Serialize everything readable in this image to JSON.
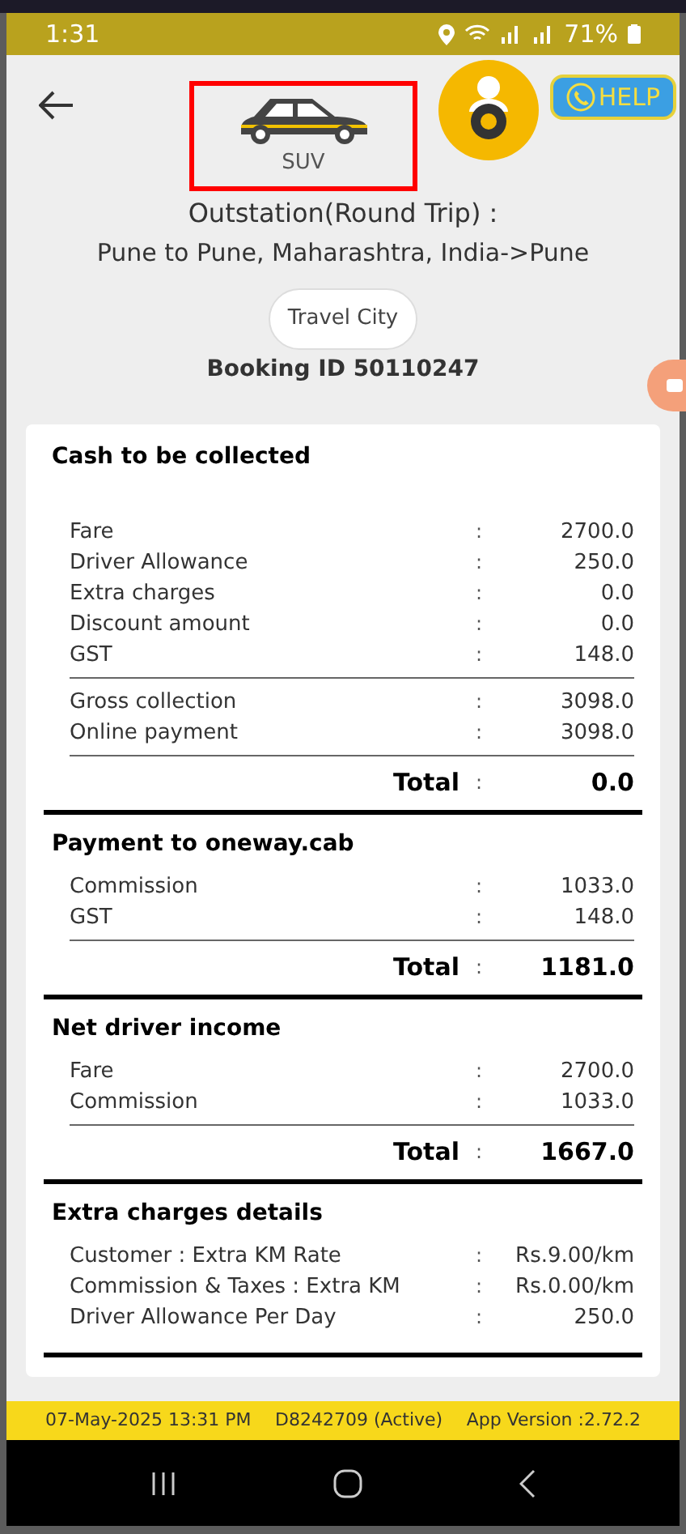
{
  "status_bar": {
    "time": "1:31",
    "battery": "71%"
  },
  "header": {
    "vehicle": "SUV",
    "help": "HELP",
    "trip_title": "Outstation(Round Trip) :",
    "route": "Pune to Pune, Maharashtra, India->Pune",
    "city_chip": "Travel City",
    "booking": "Booking ID 50110247"
  },
  "sections": [
    {
      "title": "Cash to be collected",
      "groups": [
        [
          {
            "label": "Fare",
            "sep": ":",
            "value": "2700.0"
          },
          {
            "label": "Driver Allowance",
            "sep": ":",
            "value": "250.0"
          },
          {
            "label": "Extra charges",
            "sep": ":",
            "value": "0.0"
          },
          {
            "label": "Discount amount",
            "sep": ":",
            "value": "0.0"
          },
          {
            "label": "GST",
            "sep": ":",
            "value": "148.0"
          }
        ],
        [
          {
            "label": "Gross collection",
            "sep": ":",
            "value": "3098.0"
          },
          {
            "label": "Online payment",
            "sep": ":",
            "value": "3098.0"
          }
        ]
      ],
      "total": {
        "label": "Total",
        "sep": ":",
        "value": "0.0"
      }
    },
    {
      "title": "Payment to oneway.cab",
      "groups": [
        [
          {
            "label": "Commission",
            "sep": ":",
            "value": "1033.0"
          },
          {
            "label": "GST",
            "sep": ":",
            "value": "148.0"
          }
        ]
      ],
      "total": {
        "label": "Total",
        "sep": ":",
        "value": "1181.0"
      }
    },
    {
      "title": "Net driver income",
      "groups": [
        [
          {
            "label": "Fare",
            "sep": ":",
            "value": "2700.0"
          },
          {
            "label": "Commission",
            "sep": ":",
            "value": "1033.0"
          }
        ]
      ],
      "total": {
        "label": "Total",
        "sep": ":",
        "value": "1667.0"
      }
    },
    {
      "title": "Extra charges details",
      "groups": [
        [
          {
            "label": "Customer : Extra KM Rate",
            "sep": ":",
            "value": "Rs.9.00/km"
          },
          {
            "label": "Commission & Taxes : Extra KM",
            "sep": ":",
            "value": "Rs.0.00/km"
          },
          {
            "label": "Driver Allowance Per Day",
            "sep": ":",
            "value": "250.0"
          }
        ]
      ]
    }
  ],
  "footer": {
    "datetime": "07-May-2025 13:31 PM",
    "driver": "D8242709 (Active)",
    "version": "App Version :2.72.2"
  }
}
